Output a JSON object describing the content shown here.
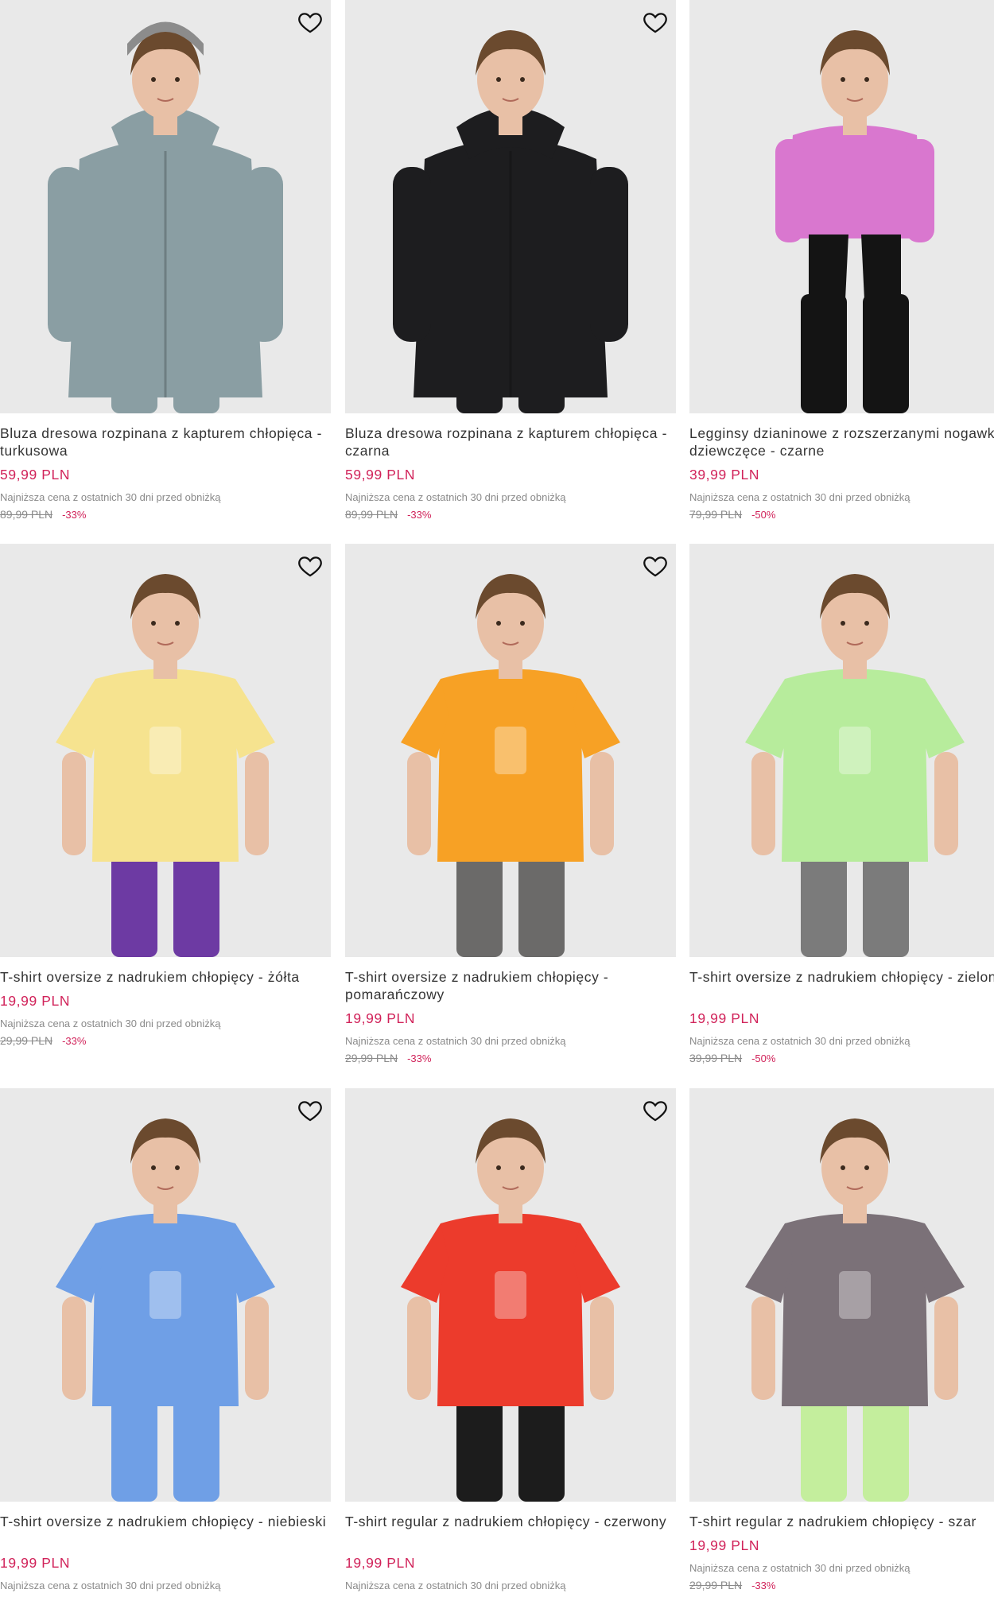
{
  "products": [
    {
      "name": "Bluza dresowa rozpinana z kapturem chłopięca - turkusowa",
      "price": "59,99 PLN",
      "lowest_label": "Najniższa cena z ostatnich 30 dni przed obniżką",
      "old_price": "89,99 PLN",
      "discount": "-33%",
      "garment_color": "#8a9ea3",
      "bottom_color": "#8a9ea3",
      "wishlist_icon": "heart-outline-icon"
    },
    {
      "name": "Bluza dresowa rozpinana z kapturem chłopięca - czarna",
      "price": "59,99 PLN",
      "lowest_label": "Najniższa cena z ostatnich 30 dni przed obniżką",
      "old_price": "89,99 PLN",
      "discount": "-33%",
      "garment_color": "#1d1d1f",
      "bottom_color": "#1d1d1f",
      "wishlist_icon": "heart-outline-icon"
    },
    {
      "name": "Legginsy dzianinowe z rozszerzanymi nogawkami dziewczęce - czarne",
      "price": "39,99 PLN",
      "lowest_label": "Najniższa cena z ostatnich 30 dni przed obniżką",
      "old_price": "79,99 PLN",
      "discount": "-50%",
      "garment_color": "#d977cf",
      "bottom_color": "#141414",
      "wishlist_icon": "heart-outline-icon"
    },
    {
      "name": "T-shirt oversize z nadrukiem chłopięcy - żółta",
      "price": "19,99 PLN",
      "lowest_label": "Najniższa cena z ostatnich 30 dni przed obniżką",
      "old_price": "29,99 PLN",
      "discount": "-33%",
      "garment_color": "#f6e38f",
      "bottom_color": "#6d3aa3",
      "wishlist_icon": "heart-outline-icon"
    },
    {
      "name": "T-shirt oversize z nadrukiem chłopięcy - pomarańczowy",
      "price": "19,99 PLN",
      "lowest_label": "Najniższa cena z ostatnich 30 dni przed obniżką",
      "old_price": "29,99 PLN",
      "discount": "-33%",
      "garment_color": "#f7a125",
      "bottom_color": "#6b6a69",
      "wishlist_icon": "heart-outline-icon"
    },
    {
      "name": "T-shirt oversize z nadrukiem chłopięcy - zielony",
      "price": "19,99 PLN",
      "lowest_label": "Najniższa cena z ostatnich 30 dni przed obniżką",
      "old_price": "39,99 PLN",
      "discount": "-50%",
      "garment_color": "#b7ec9c",
      "bottom_color": "#7b7b7b",
      "wishlist_icon": "heart-outline-icon"
    },
    {
      "name": "T-shirt oversize z nadrukiem chłopięcy - niebieski",
      "price": "19,99 PLN",
      "lowest_label": "Najniższa cena z ostatnich 30 dni przed obniżką",
      "old_price": "",
      "discount": "",
      "garment_color": "#6f9fe6",
      "bottom_color": "#6f9fe6",
      "wishlist_icon": "heart-outline-icon"
    },
    {
      "name": "T-shirt regular z nadrukiem chłopięcy - czerwony",
      "price": "19,99 PLN",
      "lowest_label": "Najniższa cena z ostatnich 30 dni przed obniżką",
      "old_price": "",
      "discount": "",
      "garment_color": "#ec3b2c",
      "bottom_color": "#1c1c1c",
      "wishlist_icon": "heart-outline-icon"
    },
    {
      "name": "T-shirt regular z nadrukiem chłopięcy - szar",
      "price": "19,99 PLN",
      "lowest_label": "Najniższa cena z ostatnich 30 dni przed obniżką",
      "old_price": "29,99 PLN",
      "discount": "-33%",
      "garment_color": "#7b7178",
      "bottom_color": "#c4ee9d",
      "wishlist_icon": "heart-outline-icon"
    }
  ]
}
